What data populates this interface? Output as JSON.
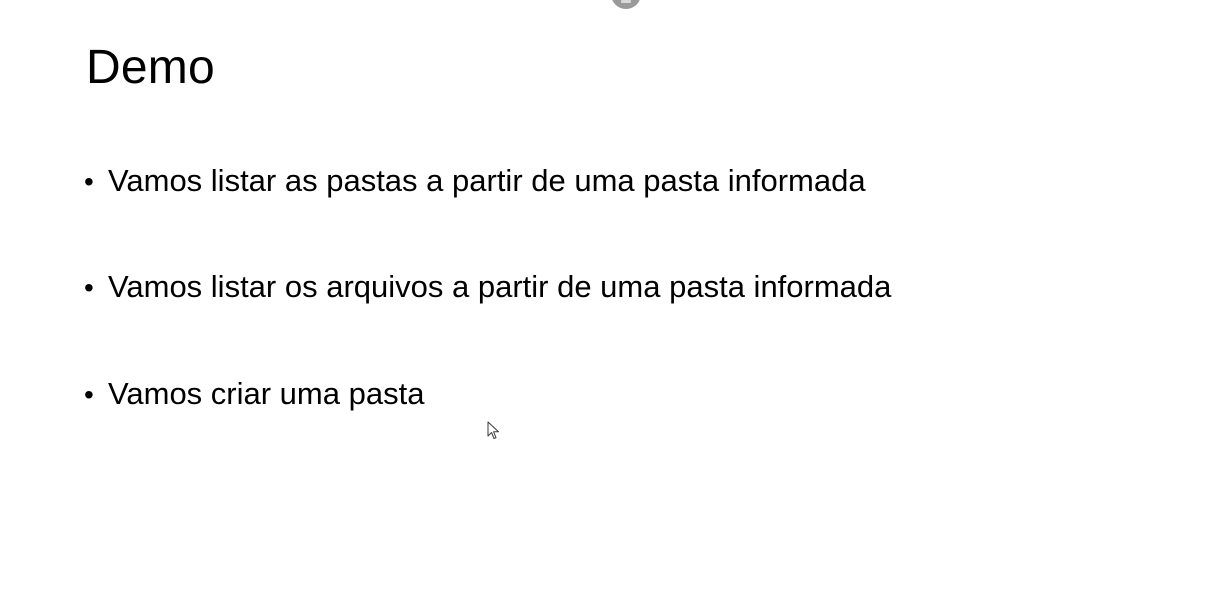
{
  "slide": {
    "title": "Demo",
    "bullet_glyph": "•",
    "bullets": [
      "Vamos listar as pastas a partir de uma pasta informada",
      "Vamos listar os arquivos a partir de uma pasta informada",
      "Vamos criar uma pasta"
    ]
  },
  "colors": {
    "background": "#ffffff",
    "text": "#000000",
    "indicator": "#9a9a9a"
  },
  "icons": {
    "pointer": "mouse-pointer-icon",
    "top_control": "presenter-toolbar-handle-icon"
  }
}
